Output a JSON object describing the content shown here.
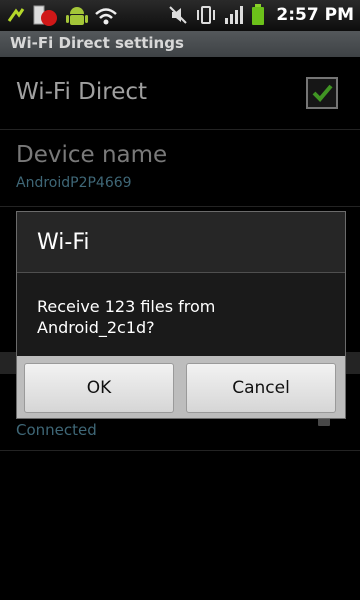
{
  "status_bar": {
    "time": "2:57 PM",
    "left_icons": [
      "usb-icon",
      "battery-warning-icon",
      "android-icon",
      "wifi-icon"
    ],
    "right_icons": [
      "mute-icon",
      "vibrate-icon",
      "signal-icon",
      "battery-icon"
    ]
  },
  "header": {
    "title": "Wi-Fi Direct settings"
  },
  "list": {
    "wifi_direct": {
      "title": "Wi-Fi Direct",
      "checked": true
    },
    "device_name": {
      "title": "Device name",
      "summary": "AndroidP2P4669"
    },
    "peer": {
      "status": "Connected"
    }
  },
  "dialog": {
    "title": "Wi-Fi",
    "message": "Receive 123 files from Android_2c1d?",
    "ok_label": "OK",
    "cancel_label": "Cancel"
  },
  "colors": {
    "accent_check": "#4caf2a",
    "summary_text": "#4a7a8c"
  }
}
